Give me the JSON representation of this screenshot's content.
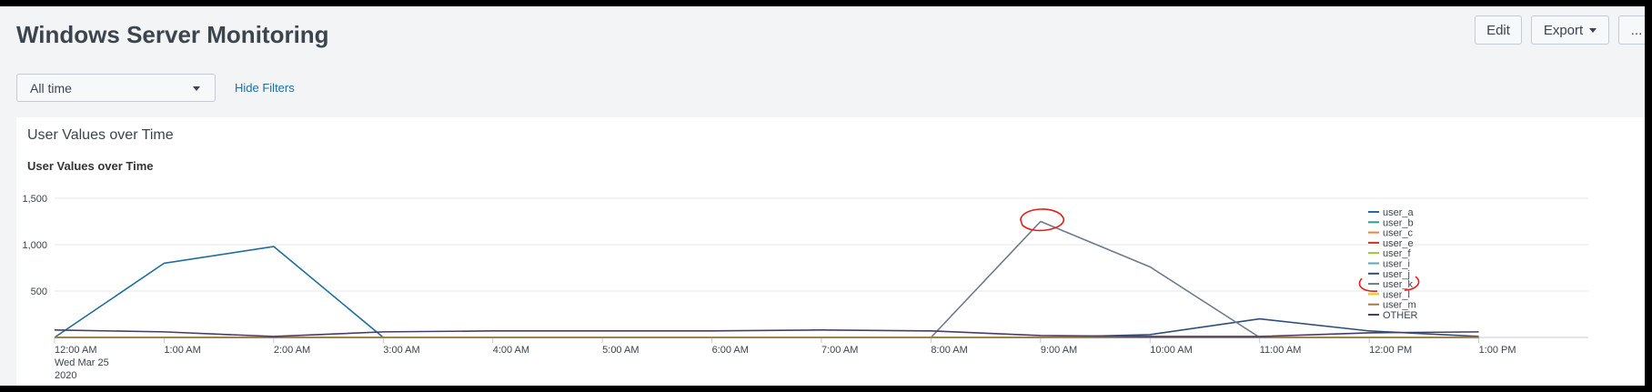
{
  "dashboard": {
    "title": "Windows Server Monitoring",
    "edit_label": "Edit",
    "export_label": "Export",
    "more_label": "..."
  },
  "filters": {
    "time_range": "All time",
    "hide_filters_label": "Hide Filters"
  },
  "panel": {
    "title": "User Values over Time",
    "viz_title": "User Values over Time"
  },
  "annotations": {
    "peak_circle_color": "#e0201b",
    "legend_mark_color": "#e0201b"
  },
  "chart_data": {
    "type": "line",
    "title": "User Values over Time",
    "y_ticks": [
      "1,500",
      "1,000",
      "500"
    ],
    "ylim": [
      0,
      1500
    ],
    "x_ticks": [
      "12:00 AM",
      "1:00 AM",
      "2:00 AM",
      "3:00 AM",
      "4:00 AM",
      "5:00 AM",
      "6:00 AM",
      "7:00 AM",
      "8:00 AM",
      "9:00 AM",
      "10:00 AM",
      "11:00 AM",
      "12:00 PM",
      "1:00 PM"
    ],
    "x_date_line1": "Wed Mar 25",
    "x_date_line2": "2020",
    "hours": [
      0,
      1,
      2,
      3,
      4,
      5,
      6,
      7,
      8,
      9,
      10,
      11,
      12,
      13
    ],
    "x_max_hours": 14,
    "grid": true,
    "legend_position": "right",
    "series": [
      {
        "name": "user_a",
        "color": "#1e6e9e",
        "values": [
          0,
          800,
          980,
          0,
          0,
          0,
          0,
          0,
          0,
          0,
          0,
          0,
          0,
          0
        ]
      },
      {
        "name": "user_b",
        "color": "#2d9a9a",
        "values": [
          0,
          0,
          0,
          0,
          0,
          0,
          0,
          0,
          0,
          0,
          0,
          0,
          0,
          0
        ]
      },
      {
        "name": "user_c",
        "color": "#f2803a",
        "values": [
          0,
          0,
          0,
          0,
          0,
          0,
          0,
          0,
          0,
          0,
          0,
          0,
          0,
          0
        ]
      },
      {
        "name": "user_e",
        "color": "#c0392b",
        "values": [
          0,
          0,
          0,
          0,
          0,
          0,
          0,
          0,
          0,
          0,
          0,
          0,
          0,
          0
        ]
      },
      {
        "name": "user_f",
        "color": "#9ac23c",
        "values": [
          0,
          0,
          0,
          0,
          0,
          0,
          0,
          0,
          0,
          0,
          0,
          0,
          0,
          0
        ]
      },
      {
        "name": "user_i",
        "color": "#5aa9b8",
        "values": [
          0,
          0,
          0,
          0,
          0,
          0,
          0,
          0,
          0,
          0,
          0,
          0,
          0,
          0
        ]
      },
      {
        "name": "user_j",
        "color": "#2f4f7a",
        "values": [
          0,
          0,
          0,
          0,
          0,
          0,
          0,
          0,
          0,
          0,
          30,
          200,
          70,
          10
        ]
      },
      {
        "name": "user_k",
        "color": "#6c7a89",
        "values": [
          0,
          0,
          0,
          0,
          0,
          0,
          0,
          0,
          0,
          1250,
          760,
          0,
          0,
          0
        ]
      },
      {
        "name": "user_l",
        "color": "#f1c40f",
        "values": [
          0,
          0,
          0,
          0,
          0,
          0,
          0,
          0,
          0,
          0,
          0,
          0,
          0,
          0
        ]
      },
      {
        "name": "user_m",
        "color": "#a0784e",
        "values": [
          0,
          0,
          0,
          0,
          0,
          0,
          0,
          0,
          0,
          0,
          0,
          0,
          0,
          0
        ]
      },
      {
        "name": "OTHER",
        "color": "#4a3b6b",
        "values": [
          80,
          60,
          10,
          60,
          70,
          70,
          70,
          80,
          70,
          20,
          10,
          10,
          50,
          60
        ]
      }
    ]
  }
}
